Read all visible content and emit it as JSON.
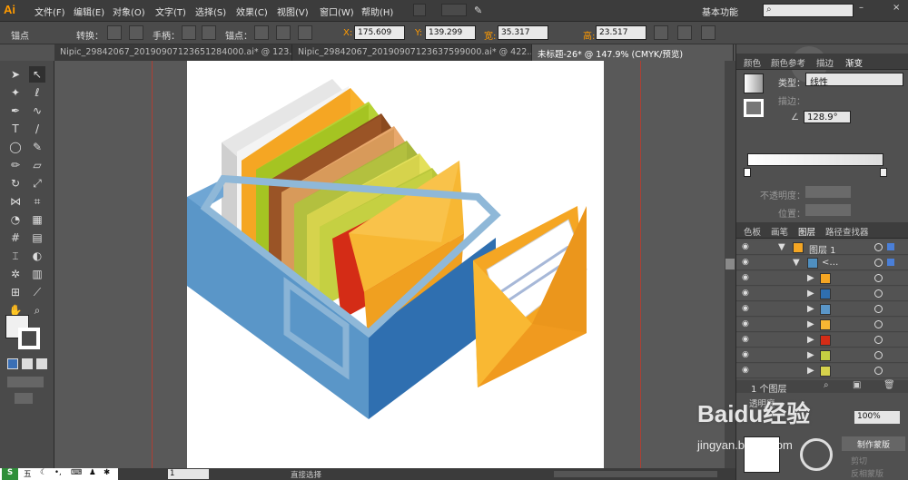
{
  "app": {
    "logo": "Ai",
    "workspace": "基本功能"
  },
  "menu": [
    "文件(F)",
    "编辑(E)",
    "对象(O)",
    "文字(T)",
    "选择(S)",
    "效果(C)",
    "视图(V)",
    "窗口(W)",
    "帮助(H)"
  ],
  "control": {
    "label": "锚点",
    "convert": "转换：",
    "handle": "手柄：",
    "anchor": "锚点：",
    "x_label": "X:",
    "x": "175.609",
    "y_label": "Y:",
    "y": "139.299",
    "w_label": "宽:",
    "w": "35.317",
    "h_label": "高:",
    "h": "23.517",
    "unit": "m"
  },
  "tabs": [
    {
      "label": "Nipic_29842067_20190907123651284000.ai* @ 123…"
    },
    {
      "label": "Nipic_29842067_20190907123637599000.ai* @ 422…"
    },
    {
      "label": "未标题-26* @ 147.9% (CMYK/预览)"
    }
  ],
  "gradient_panel": {
    "tabs": [
      "颜色",
      "颜色参考",
      "描边",
      "渐变"
    ],
    "type_label": "类型：",
    "type_value": "线性",
    "stroke_label": "描边：",
    "angle": "128.9°",
    "opacity_label": "不透明度：",
    "position_label": "位置："
  },
  "layers_panel": {
    "tabs": [
      "色板",
      "画笔",
      "图层",
      "路径查找器"
    ],
    "layer_name": "图层 1",
    "group_name": "<…",
    "count": "1 个图层"
  },
  "transparency": {
    "tab": "透明度",
    "opacity": "100%",
    "make_mask": "制作蒙版",
    "clip": "剪切",
    "invert": "反相蒙版"
  },
  "status": {
    "zoom": "1",
    "tool": "直接选择"
  },
  "watermark": {
    "line1": "Baidu经验",
    "line2": "jingyan.baidu.com"
  },
  "taskbar": {
    "ime": "五"
  },
  "colors": {
    "accent": "#ff9a00",
    "box_blue": "#4f8fc0",
    "orange": "#f5a623"
  }
}
